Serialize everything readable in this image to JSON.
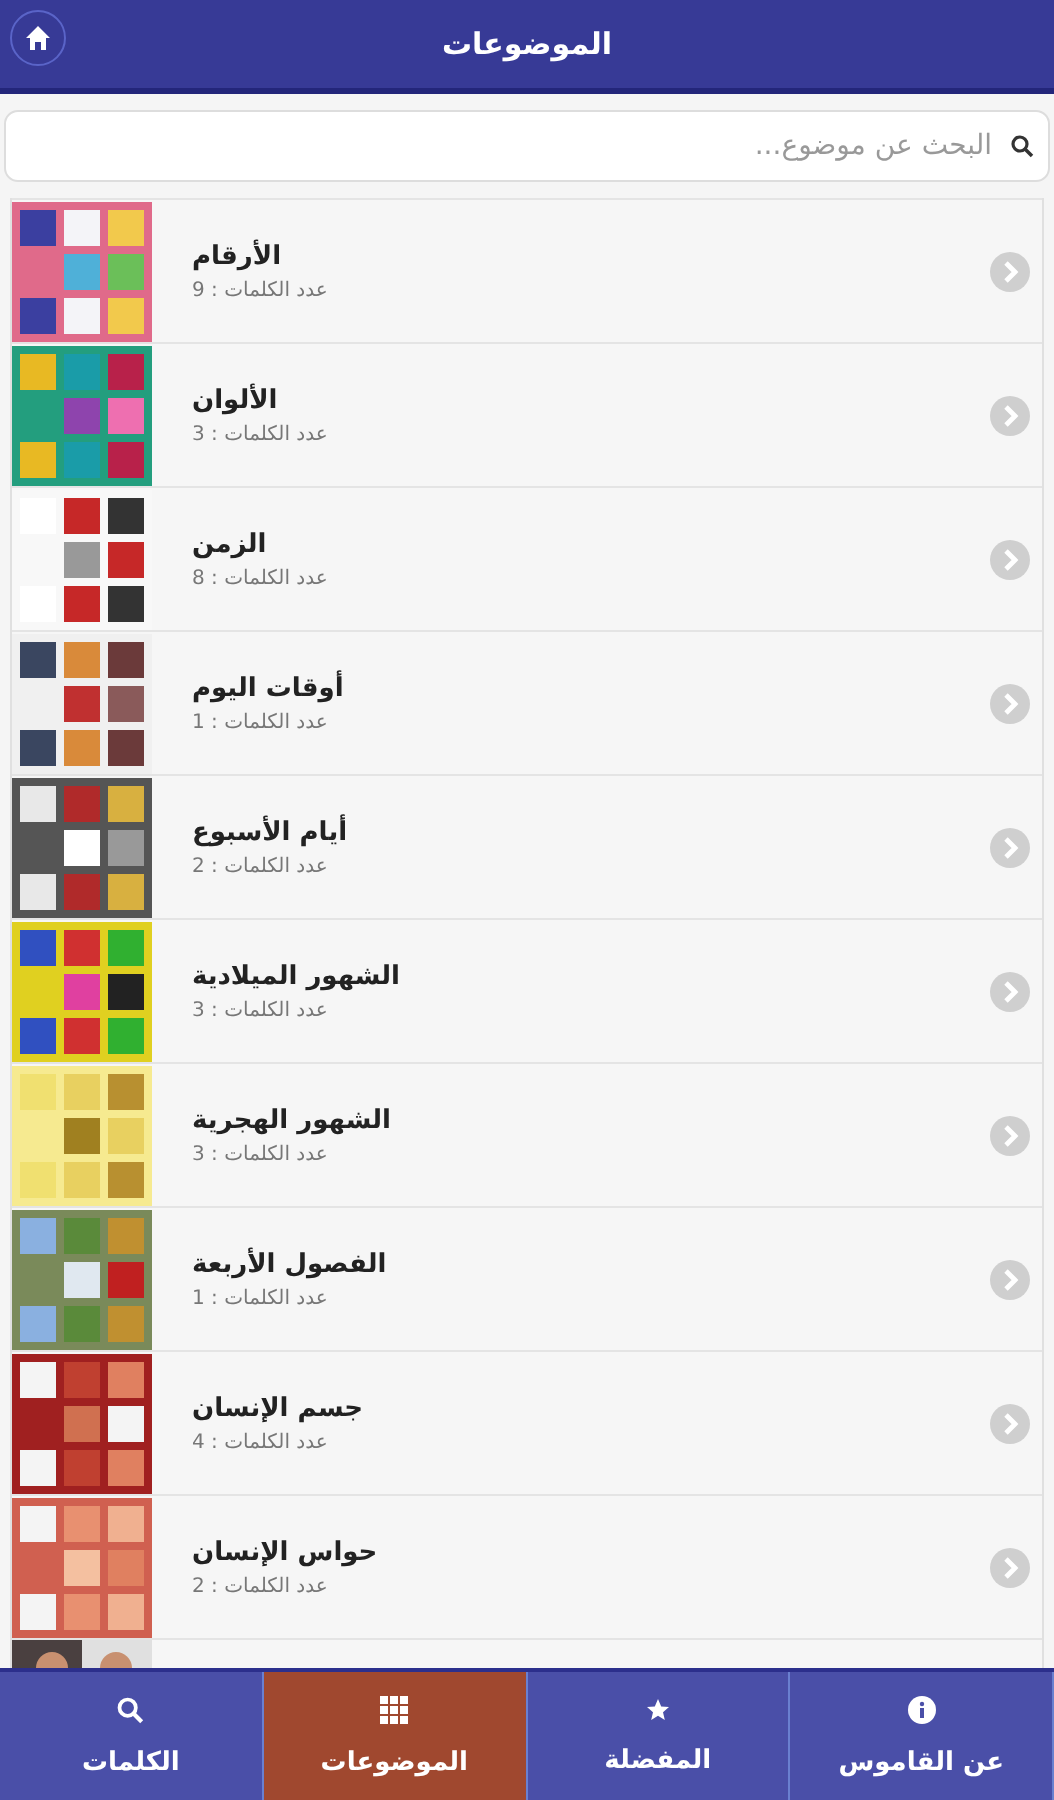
{
  "header": {
    "title": "الموضوعات"
  },
  "search": {
    "placeholder": "البحث عن موضوع..."
  },
  "topics": [
    {
      "title": "الأرقام",
      "count": "عدد الكلمات : 9"
    },
    {
      "title": "الألوان",
      "count": "عدد الكلمات : 3"
    },
    {
      "title": "الزمن",
      "count": "عدد الكلمات : 8"
    },
    {
      "title": "أوقات اليوم",
      "count": "عدد الكلمات : 1"
    },
    {
      "title": "أيام الأسبوع",
      "count": "عدد الكلمات : 2"
    },
    {
      "title": "الشهور الميلادية",
      "count": "عدد الكلمات : 3"
    },
    {
      "title": "الشهور الهجرية",
      "count": "عدد الكلمات : 3"
    },
    {
      "title": "الفصول الأربعة",
      "count": "عدد الكلمات : 1"
    },
    {
      "title": "جسم الإنسان",
      "count": "عدد الكلمات : 4"
    },
    {
      "title": "حواس الإنسان",
      "count": "عدد الكلمات : 2"
    }
  ],
  "tabs": [
    {
      "label": "عن القاموس",
      "kind": "info",
      "selected": false
    },
    {
      "label": "المفضلة",
      "kind": "star",
      "selected": false
    },
    {
      "label": "الموضوعات",
      "kind": "grid",
      "selected": true
    },
    {
      "label": "الكلمات",
      "kind": "search",
      "selected": false
    }
  ]
}
